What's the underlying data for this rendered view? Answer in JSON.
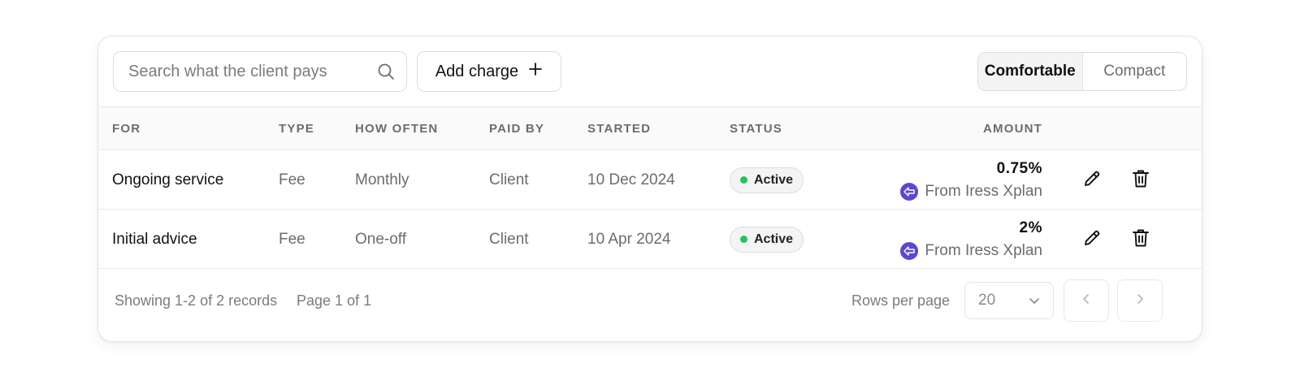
{
  "search": {
    "placeholder": "Search what the client pays",
    "value": ""
  },
  "toolbar": {
    "add_label": "Add charge"
  },
  "density": {
    "options": [
      "Comfortable",
      "Compact"
    ],
    "selected": "Comfortable"
  },
  "table": {
    "columns": [
      "FOR",
      "TYPE",
      "HOW OFTEN",
      "PAID BY",
      "STARTED",
      "STATUS",
      "AMOUNT"
    ],
    "rows": [
      {
        "for": "Ongoing service",
        "type": "Fee",
        "how_often": "Monthly",
        "paid_by": "Client",
        "started": "10 Dec 2024",
        "status": "Active",
        "amount": "0.75%",
        "source": "From Iress Xplan"
      },
      {
        "for": "Initial advice",
        "type": "Fee",
        "how_often": "One-off",
        "paid_by": "Client",
        "started": "10 Apr 2024",
        "status": "Active",
        "amount": "2%",
        "source": "From Iress Xplan"
      }
    ]
  },
  "footer": {
    "records": "Showing 1-2 of 2 records",
    "page": "Page 1 of 1",
    "rows_per_page_label": "Rows per page",
    "rows_per_page_value": "20"
  },
  "colors": {
    "status_active": "#22c55e",
    "source_logo": "#5b46d6"
  },
  "icons": {
    "search": "search-icon",
    "add": "plus-icon",
    "edit": "pencil-icon",
    "delete": "trash-icon",
    "source": "iress-xplan-logo-icon",
    "dropdown": "chevron-down-icon",
    "prev": "chevron-left-icon",
    "next": "chevron-right-icon"
  }
}
